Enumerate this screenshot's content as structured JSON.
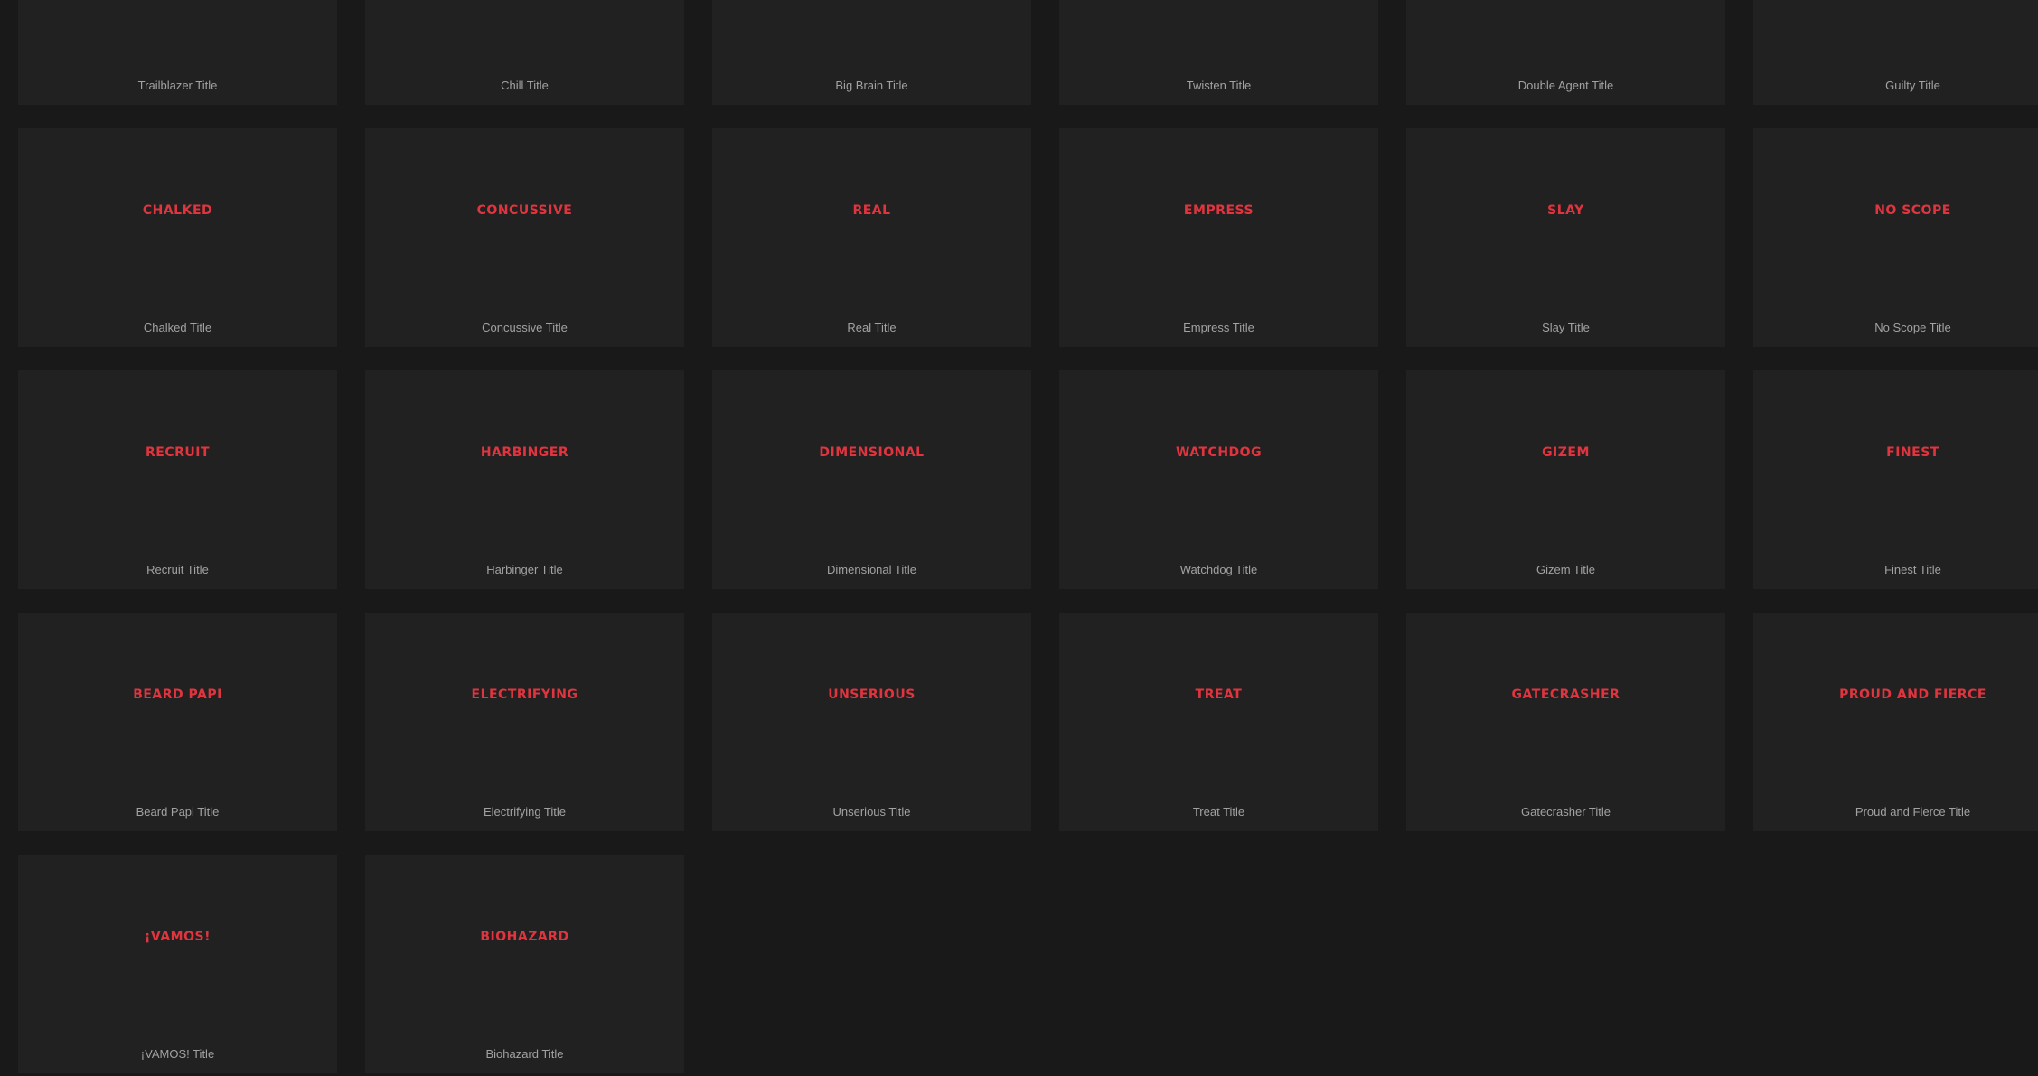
{
  "theme": {
    "background": "#1a191a",
    "card_background": "#222122",
    "title_color": "#e0353f",
    "label_color": "#a3a1a3"
  },
  "top_row": [
    {
      "label": "Trailblazer Title"
    },
    {
      "label": "Chill Title"
    },
    {
      "label": "Big Brain Title"
    },
    {
      "label": "Twisten Title"
    },
    {
      "label": "Double Agent Title"
    },
    {
      "label": "Guilty Title"
    }
  ],
  "titles": [
    {
      "art": "CHALKED",
      "label": "Chalked Title"
    },
    {
      "art": "CONCUSSIVE",
      "label": "Concussive Title"
    },
    {
      "art": "REAL",
      "label": "Real Title"
    },
    {
      "art": "EMPRESS",
      "label": "Empress Title"
    },
    {
      "art": "SLAY",
      "label": "Slay Title"
    },
    {
      "art": "NO SCOPE",
      "label": "No Scope Title"
    },
    {
      "art": "RECRUIT",
      "label": "Recruit Title"
    },
    {
      "art": "HARBINGER",
      "label": "Harbinger Title"
    },
    {
      "art": "DIMENSIONAL",
      "label": "Dimensional Title"
    },
    {
      "art": "WATCHDOG",
      "label": "Watchdog Title"
    },
    {
      "art": "GIZEM",
      "label": "Gizem Title"
    },
    {
      "art": "FINEST",
      "label": "Finest Title"
    },
    {
      "art": "BEARD PAPI",
      "label": "Beard Papi Title"
    },
    {
      "art": "ELECTRIFYING",
      "label": "Electrifying Title"
    },
    {
      "art": "UNSERIOUS",
      "label": "Unserious Title"
    },
    {
      "art": "TREAT",
      "label": "Treat Title"
    },
    {
      "art": "GATECRASHER",
      "label": "Gatecrasher Title"
    },
    {
      "art": "PROUD AND FIERCE",
      "label": "Proud and Fierce Title"
    },
    {
      "art": "¡VAMOS!",
      "label": "¡VAMOS! Title"
    },
    {
      "art": "BIOHAZARD",
      "label": "Biohazard Title"
    }
  ]
}
